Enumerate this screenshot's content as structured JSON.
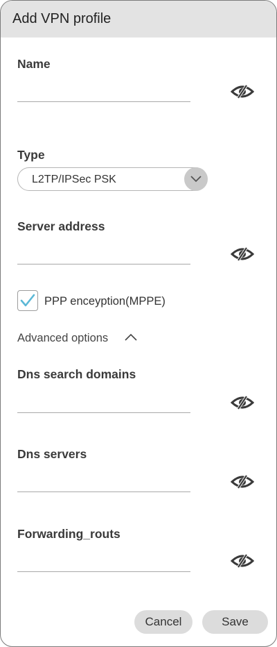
{
  "dialog": {
    "title": "Add VPN profile"
  },
  "fields": {
    "name": {
      "label": "Name",
      "value": ""
    },
    "type": {
      "label": "Type",
      "selected": "L2TP/IPSec PSK"
    },
    "server_address": {
      "label": "Server address",
      "value": ""
    },
    "dns_search_domains": {
      "label": "Dns search domains",
      "value": ""
    },
    "dns_servers": {
      "label": "Dns servers",
      "value": ""
    },
    "forwarding_routs": {
      "label": "Forwarding_routs",
      "value": ""
    }
  },
  "ppp_encryption": {
    "label": "PPP enceyption(MPPE)",
    "checked": true
  },
  "advanced": {
    "label": "Advanced options",
    "expanded": true
  },
  "buttons": {
    "cancel": "Cancel",
    "save": "Save"
  },
  "icons": {
    "visibility": "eye-off-icon",
    "dropdown": "chevron-down-icon",
    "check": "check-icon",
    "collapse": "chevron-up-icon"
  },
  "colors": {
    "titlebar_bg": "#e3e3e3",
    "check_color": "#5bb8d6",
    "button_bg": "#dcdcdc",
    "eye_color": "#3a3a3a"
  }
}
